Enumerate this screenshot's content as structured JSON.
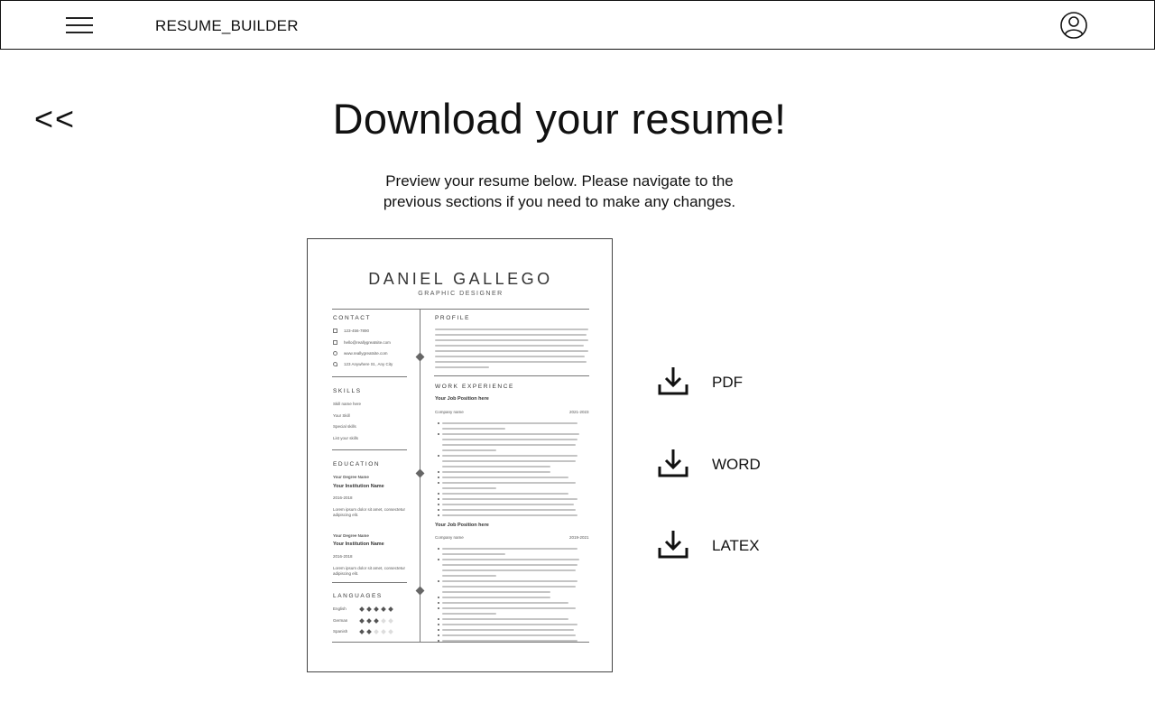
{
  "header": {
    "app_title": "RESUME_BUILDER",
    "menu_icon": "hamburger-menu-icon",
    "account_icon": "user-account-icon"
  },
  "nav": {
    "back_label": "<<"
  },
  "main": {
    "title": "Download your resume!",
    "subtitle": "Preview your resume below. Please navigate to the previous sections if you need to make any changes."
  },
  "resume_preview": {
    "name": "DANIEL GALLEGO",
    "role": "GRAPHIC DESIGNER",
    "sections": {
      "contact": "CONTACT",
      "skills": "SKILLS",
      "education": "EDUCATION",
      "languages": "LANGUAGES",
      "profile": "PROFILE",
      "work": "WORK EXPERIENCE"
    },
    "contact": [
      "123-456-7890",
      "hello@reallygreatsite.com",
      "www.reallygreatsite.com",
      "123 Anywhere St., Any City"
    ],
    "skills": [
      "Skill name here",
      "Your Skill",
      "Special skills",
      "List your skills"
    ],
    "education": [
      {
        "degree": "Your Degree Name",
        "institution": "Your Institution Name",
        "years": "2016-2018",
        "text": "Lorem ipsum dolor sit amet, consectetur adipiscing elit."
      },
      {
        "degree": "Your Degree Name",
        "institution": "Your Institution Name",
        "years": "2016-2018",
        "text": "Lorem ipsum dolor sit amet, consectetur adipiscing elit."
      }
    ],
    "languages": [
      {
        "name": "English",
        "level": 5
      },
      {
        "name": "German",
        "level": 3
      },
      {
        "name": "Spanish",
        "level": 2
      }
    ],
    "jobs": [
      {
        "title": "Your Job Position here",
        "company": "Company name",
        "years": "2021-2023"
      },
      {
        "title": "Your Job Position here",
        "company": "Company name",
        "years": "2019-2021"
      }
    ]
  },
  "downloads": [
    {
      "label": "PDF",
      "icon": "download-icon"
    },
    {
      "label": "WORD",
      "icon": "download-icon"
    },
    {
      "label": "LATEX",
      "icon": "download-icon"
    }
  ]
}
